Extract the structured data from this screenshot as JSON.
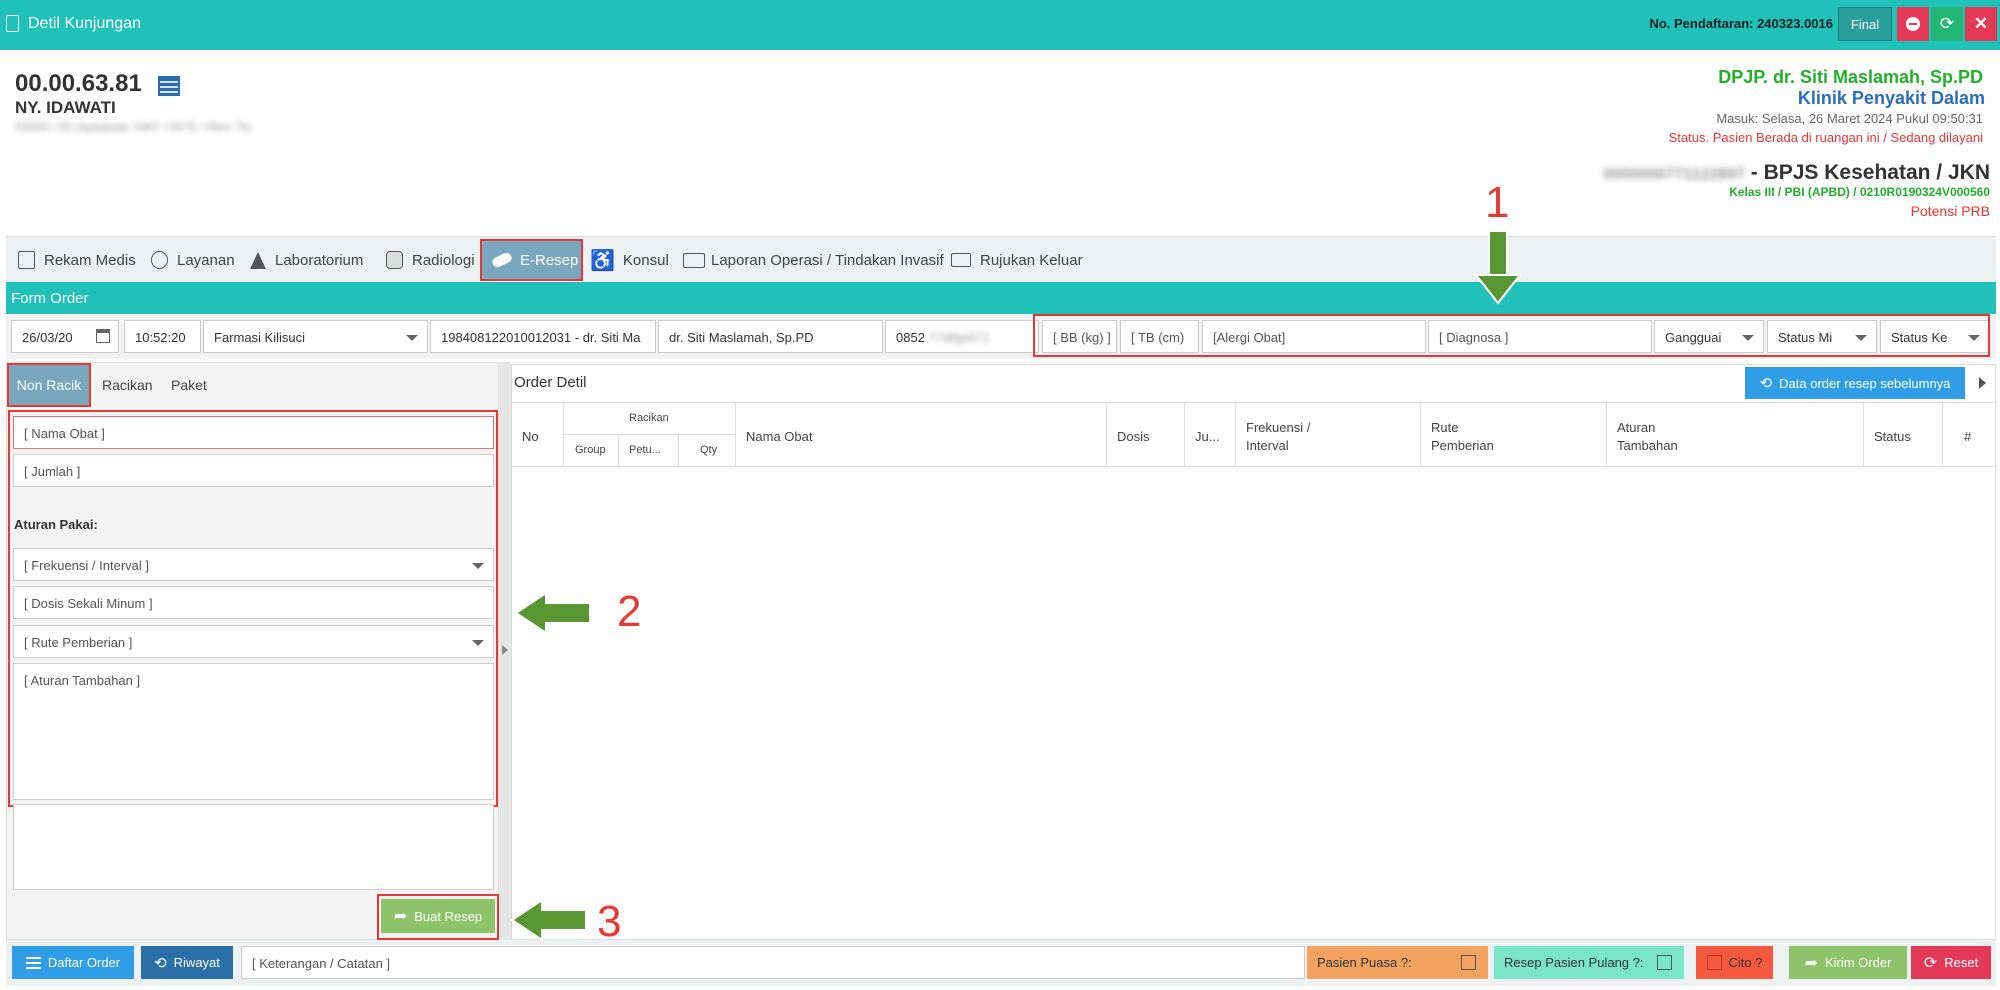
{
  "window": {
    "title": "Detil Kunjungan",
    "registration": "No. Pendaftaran: 240323.0016",
    "final_label": "Final"
  },
  "patient": {
    "id": "00.00.63.81",
    "name": "NY. IDAWATI",
    "blurred_detail": "00000 / 00 (Aptaitstar 1967 / 0075 / Rbm 7k)"
  },
  "visit": {
    "dpjp": "DPJP. dr. Siti Maslamah, Sp.PD",
    "clinic": "Klinik Penyakit Dalam",
    "entry": "Masuk: Selasa, 26 Maret 2024 Pukul 09:50:31",
    "status": "Status. Pasien Berada di ruangan ini / Sedang dilayani",
    "insurance_blur": "0000000771122897",
    "insurance": " - BPJS Kesehatan / JKN",
    "kelas": "Kelas III / PBI (APBD) / 0210R0190324V000560",
    "prb": "Potensi PRB"
  },
  "tabs": [
    "Rekam Medis",
    "Layanan",
    "Laboratorium",
    "Radiologi",
    "E-Resep",
    "Konsul",
    "Laporan Operasi / Tindakan Invasif",
    "Rujukan Keluar"
  ],
  "form_order": {
    "header": "Form Order",
    "date": "26/03/20",
    "time": "10:52:20",
    "farmasi": "Farmasi Kilisuci",
    "doctor_nip": "198408122010012031 - dr. Siti Ma",
    "doctor": "dr. Siti Maslamah, Sp.PD",
    "phone": "0852",
    "phone_blur": "7798pt471",
    "bb": "[ BB (kg) ]",
    "tb": "[ TB (cm)",
    "alergi": "[Alergi Obat]",
    "diagnosa": "[ Diagnosa ]",
    "gangguan": "Gangguai",
    "status_m": "Status Mi",
    "status_k": "Status Ke"
  },
  "subtabs": [
    "Non Racik",
    "Racikan",
    "Paket"
  ],
  "form": {
    "nama_obat": "[ Nama Obat ]",
    "jumlah": "[ Jumlah ]",
    "aturan_label": "Aturan Pakai:",
    "frekuensi": "[ Frekuensi / Interval ]",
    "dosis": "[ Dosis Sekali Minum ]",
    "rute": "[ Rute Pemberian ]",
    "aturan_tambahan": "[ Aturan Tambahan ]",
    "buat_resep": "Buat Resep"
  },
  "order_detil": {
    "title": "Order Detil",
    "prev_btn": "Data order resep sebelumnya",
    "cols": {
      "no": "No",
      "racikan": "Racikan",
      "group": "Group",
      "petu": "Petu...",
      "qty": "Qty",
      "nama": "Nama Obat",
      "dosis": "Dosis",
      "ju": "Ju...",
      "frek1": "Frekuensi /",
      "frek2": "Interval",
      "rute1": "Rute",
      "rute2": "Pemberian",
      "aturan1": "Aturan",
      "aturan2": "Tambahan",
      "status": "Status",
      "hash": "#"
    }
  },
  "footer": {
    "daftar": "Daftar Order",
    "riwayat": "Riwayat",
    "keterangan": "[ Keterangan / Catatan ]",
    "puasa": "Pasien Puasa ?:",
    "pulang": "Resep Pasien Pulang ?:",
    "cito": "Cito ?",
    "kirim": "Kirim Order",
    "reset": "Reset"
  },
  "annotations": {
    "n1": "1",
    "n2": "2",
    "n3": "3"
  }
}
